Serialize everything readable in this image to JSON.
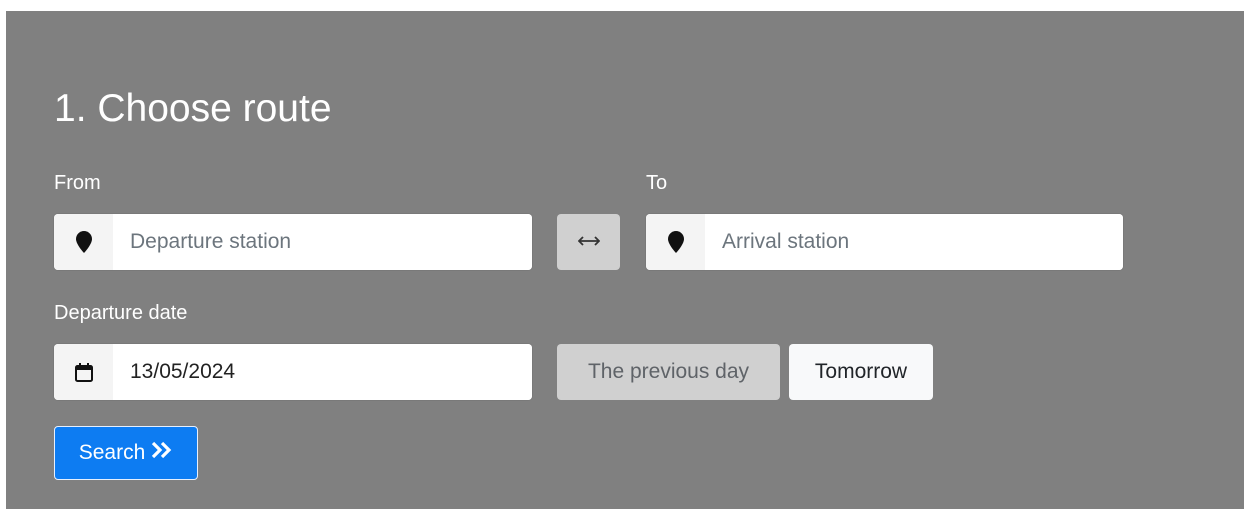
{
  "route": {
    "title": "1. Choose route",
    "from_label": "From",
    "to_label": "To",
    "departure_placeholder": "Departure station",
    "departure_value": "",
    "arrival_placeholder": "Arrival station",
    "arrival_value": "",
    "date_label": "Departure date",
    "date_value": "13/05/2024",
    "previous_day_label": "The previous day",
    "tomorrow_label": "Tomorrow",
    "search_label": "Search"
  },
  "icons": {
    "location": "map-marker-icon",
    "swap": "swap-arrows-icon",
    "calendar": "calendar-icon",
    "search": "double-chevron-right-icon"
  },
  "colors": {
    "panel_background": "#808080",
    "primary_button": "#0d7cf2",
    "disabled_button": "#d0d0d0",
    "light_button": "#f8f9fa"
  }
}
